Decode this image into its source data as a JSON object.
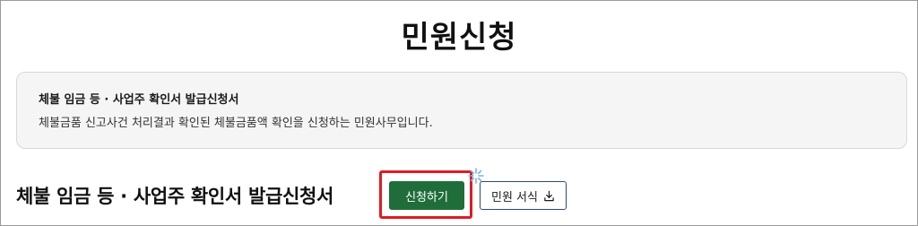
{
  "page": {
    "title": "민원신청"
  },
  "info_box": {
    "title": "체불 임금 등 · 사업주 확인서 발급신청서",
    "description": "체불금품 신고사건 처리결과 확인된 체불금품액 확인을 신청하는 민원사무입니다."
  },
  "section": {
    "title": "체불 임금 등 · 사업주 확인서 발급신청서"
  },
  "buttons": {
    "apply_label": "신청하기",
    "form_label": "민원 서식"
  },
  "colors": {
    "apply_button_bg": "#1f6e3a",
    "highlight_border": "#e01b24",
    "form_button_border": "#2b4a7a",
    "info_box_bg": "#f5f5f5"
  },
  "icons": {
    "form_download": "download-icon",
    "click_indicator": "click-spark-icon"
  }
}
